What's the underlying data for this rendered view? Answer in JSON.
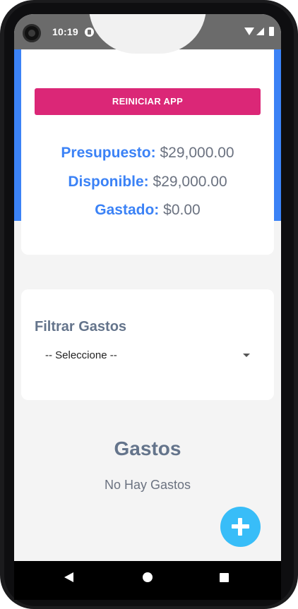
{
  "status_bar": {
    "time": "10:19",
    "icons": [
      "camera-icon",
      "app-notification-icon",
      "wifi-icon",
      "signal-icon",
      "battery-icon"
    ]
  },
  "budget": {
    "reset_button": "REINICIAR APP",
    "lines": [
      {
        "label": "Presupuesto:",
        "value": "$29,000.00"
      },
      {
        "label": "Disponible:",
        "value": "$29,000.00"
      },
      {
        "label": "Gastado:",
        "value": "$0.00"
      }
    ]
  },
  "filter": {
    "title": "Filtrar Gastos",
    "selected": "-- Seleccione --"
  },
  "expenses": {
    "title": "Gastos",
    "empty_message": "No Hay Gastos"
  },
  "nav_bar": {
    "icons": [
      "back-icon",
      "home-icon",
      "recents-icon"
    ]
  },
  "colors": {
    "primary": "#3b82f6",
    "reset_button": "#db2777",
    "fab": "#38bdf8",
    "heading_gray": "#64748b"
  }
}
